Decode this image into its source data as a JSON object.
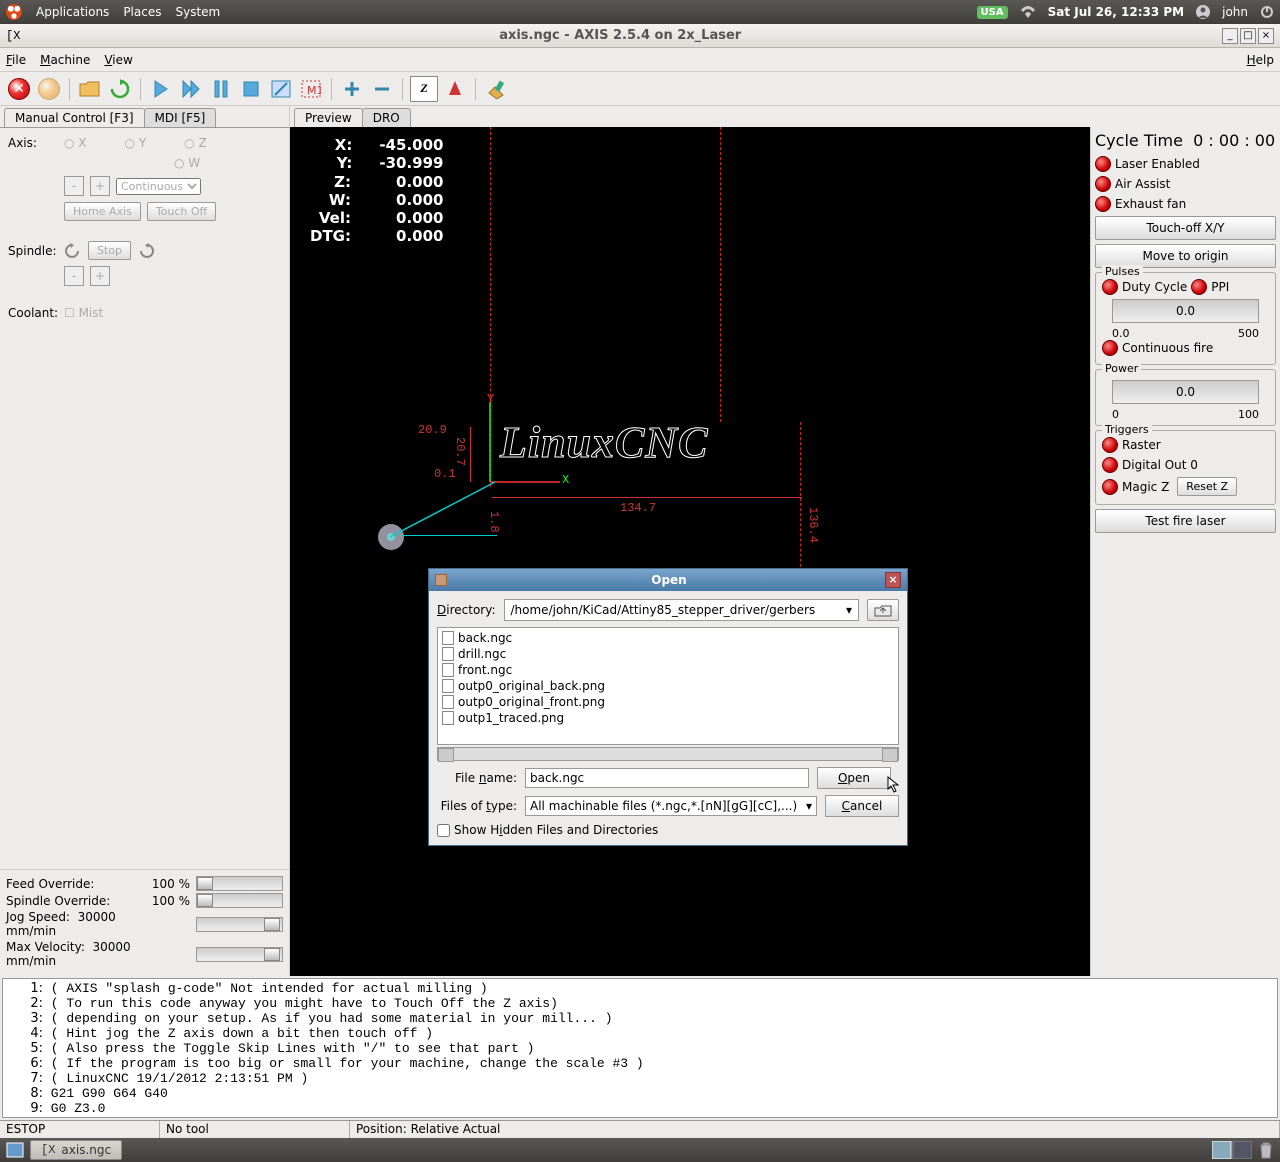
{
  "gnome": {
    "apps": "Applications",
    "places": "Places",
    "system": "System",
    "kb": "USA",
    "clock": "Sat Jul 26, 12:33 PM",
    "user": "john"
  },
  "window": {
    "title": "axis.ngc - AXIS 2.5.4 on 2x_Laser"
  },
  "menu": {
    "file": "File",
    "machine": "Machine",
    "view": "View",
    "help": "Help"
  },
  "tabs": {
    "manual": "Manual Control [F3]",
    "mdi": "MDI [F5]",
    "preview": "Preview",
    "dro": "DRO"
  },
  "axis_section": {
    "label": "Axis:",
    "axes": [
      "X",
      "Y",
      "Z",
      "W"
    ],
    "minus": "-",
    "plus": "+",
    "mode": "Continuous",
    "home": "Home Axis",
    "touch": "Touch Off"
  },
  "spindle": {
    "label": "Spindle:",
    "stop": "Stop",
    "minus": "-",
    "plus": "+"
  },
  "coolant": {
    "label": "Coolant:",
    "mist": "Mist"
  },
  "overrides": {
    "feed_l": "Feed Override:",
    "feed_v": "100 %",
    "spin_l": "Spindle Override:",
    "spin_v": "100 %",
    "jog_l": "Jog Speed:",
    "jog_v": "30000 mm/min",
    "max_l": "Max Velocity:",
    "max_v": "30000 mm/min"
  },
  "dro": {
    "x_l": "X:",
    "x": "-45.000",
    "y_l": "Y:",
    "y": "-30.999",
    "z_l": "Z:",
    "z": "0.000",
    "w_l": "W:",
    "w": "0.000",
    "vel_l": "Vel:",
    "vel": "0.000",
    "dtg_l": "DTG:",
    "dtg": "0.000"
  },
  "preview": {
    "logo": "LinuxCNC",
    "dim_w": "134.7",
    "dim_h": "20.7",
    "dim_top": "20.9",
    "dim_bot": "0.1",
    "dim_r": "136.4",
    "dim_mid": "1.8",
    "y_axis": "Y",
    "x_axis": "X"
  },
  "laser": {
    "cycle": "Cycle Time",
    "cycle_v": "0 : 00 : 00",
    "enabled": "Laser Enabled",
    "air": "Air Assist",
    "exhaust": "Exhaust fan",
    "touchxy": "Touch-off X/Y",
    "origin": "Move to origin",
    "pulses": "Pulses",
    "duty": "Duty Cycle",
    "ppi": "PPI",
    "pulses_v": "0.0",
    "p0": "0.0",
    "p1": "500",
    "cfire": "Continuous fire",
    "power": "Power",
    "power_v": "0.0",
    "pw0": "0",
    "pw1": "100",
    "triggers": "Triggers",
    "raster": "Raster",
    "digout": "Digital Out 0",
    "magicz": "Magic Z",
    "resetz": "Reset Z",
    "test": "Test fire laser"
  },
  "gcode": [
    "( AXIS \"splash g-code\" Not intended for actual milling )",
    "( To run this code anyway you might have to Touch Off the Z axis)",
    "( depending on your setup. As if you had some material in your mill... )",
    "( Hint jog the Z axis down a bit then touch off )",
    "( Also press the Toggle Skip Lines with \"/\" to see that part )",
    "( If the program is too big or small for your machine, change the scale #3 )",
    "( LinuxCNC 19/1/2012 2:13:51 PM )",
    "G21 G90 G64 G40",
    "G0 Z3.0"
  ],
  "status": {
    "estop": "ESTOP",
    "tool": "No tool",
    "pos": "Position: Relative Actual"
  },
  "taskbar": {
    "task": "axis.ngc"
  },
  "dialog": {
    "title": "Open",
    "dir_l": "Directory:",
    "dir": "/home/john/KiCad/Attiny85_stepper_driver/gerbers",
    "files": [
      "back.ngc",
      "drill.ngc",
      "front.ngc",
      "outp0_original_back.png",
      "outp0_original_front.png",
      "outp1_traced.png"
    ],
    "fname_l": "File name:",
    "fname": "back.ngc",
    "ftype_l": "Files of type:",
    "ftype": "All machinable files (*.ngc,*.[nN][gG][cC],...)",
    "open": "Open",
    "cancel": "Cancel",
    "hidden": "Show Hidden Files and Directories"
  }
}
